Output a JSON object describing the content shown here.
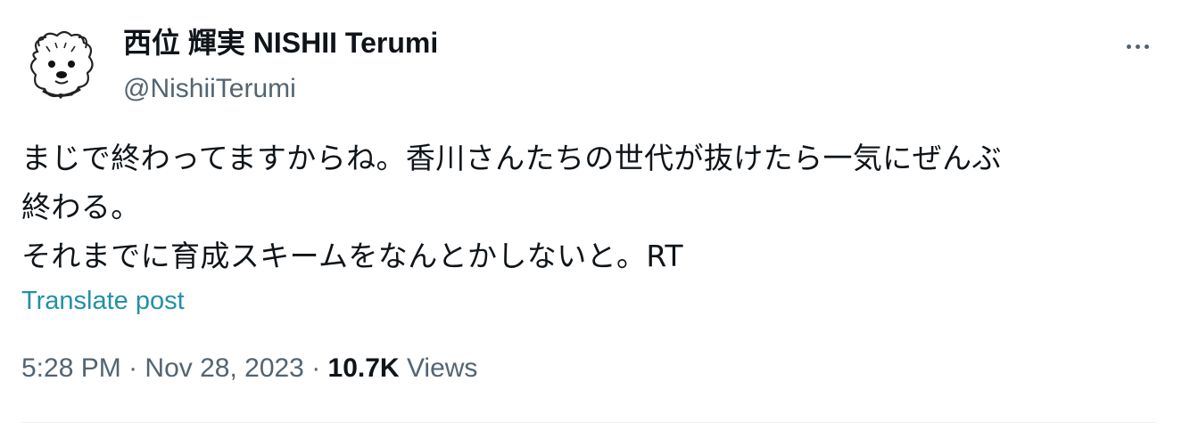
{
  "author": {
    "display_name": "西位 輝実 NISHII Terumi",
    "handle": "@NishiiTerumi",
    "avatar_icon": "dog-sketch-avatar-icon"
  },
  "menu": {
    "more_icon": "more-horizontal-icon"
  },
  "post": {
    "text_lines": [
      "まじで終わってますからね。香川さんたちの世代が抜けたら一気にぜんぶ",
      "終わる。",
      "それまでに育成スキームをなんとかしないと。RT"
    ],
    "translate_label": "Translate post"
  },
  "meta": {
    "time": "5:28 PM",
    "separator": " · ",
    "date": "Nov 28, 2023",
    "views_count": "10.7K",
    "views_label": " Views"
  },
  "colors": {
    "text_primary": "#0f1419",
    "text_secondary": "#536471",
    "link": "#2290a8",
    "divider": "#eff3f4"
  }
}
